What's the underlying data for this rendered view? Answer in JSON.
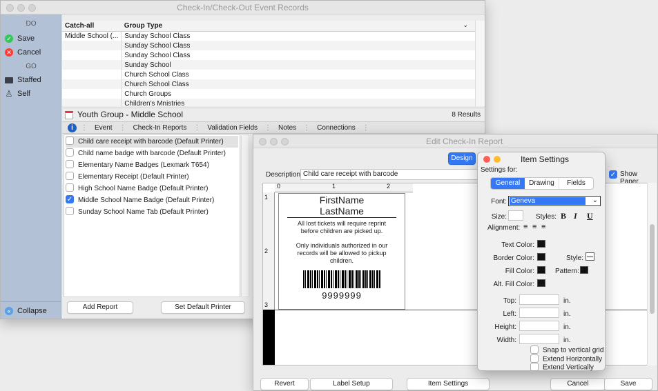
{
  "main_window": {
    "title": "Check-In/Check-Out Event Records",
    "sidebar": {
      "do_heading": "DO",
      "go_heading": "GO",
      "items": [
        {
          "label": "Save",
          "icon": "check-icon",
          "color": "#34c759"
        },
        {
          "label": "Cancel",
          "icon": "x-icon",
          "color": "#ff3b30"
        },
        {
          "label": "Staffed",
          "icon": "monitor-icon"
        },
        {
          "label": "Self",
          "icon": "person-icon"
        }
      ],
      "collapse_label": "Collapse"
    },
    "table": {
      "headers": [
        "Catch-all",
        "Group Type"
      ],
      "rows": [
        [
          "Middle School (...",
          "Sunday School Class"
        ],
        [
          "",
          "Sunday School Class"
        ],
        [
          "",
          "Sunday School Class"
        ],
        [
          "",
          "Sunday School"
        ],
        [
          "",
          "Church School Class"
        ],
        [
          "",
          "Church School Class"
        ],
        [
          "",
          "Church Groups"
        ],
        [
          "",
          "Children's Mnistries"
        ]
      ]
    },
    "record_title": "Youth Group - Middle School",
    "results": "8 Results",
    "tabs": [
      "Event",
      "Check-In Reports",
      "Validation Fields",
      "Notes",
      "Connections"
    ],
    "reports": [
      {
        "label": "Child care receipt with barcode (Default Printer)",
        "checked": false,
        "selected": true
      },
      {
        "label": "Child name badge with barcode (Default Printer)",
        "checked": false
      },
      {
        "label": "Elementary Name Badges (Lexmark T654)",
        "checked": false
      },
      {
        "label": "Elementary Receipt (Default Printer)",
        "checked": false
      },
      {
        "label": "High School Name Badge (Default Printer)",
        "checked": false
      },
      {
        "label": "Middle School Name Badge (Default Printer)",
        "checked": true
      },
      {
        "label": "Sunday School Name Tab (Default Printer)",
        "checked": false
      }
    ],
    "add_report": "Add Report",
    "set_default_printer": "Set Default Printer"
  },
  "edit_window": {
    "title": "Edit Check-In Report",
    "design_button": "Design",
    "description_label": "Description:",
    "description_value": "Child care receipt with barcode",
    "show_paper": "Show Paper",
    "ruler_top": [
      "0",
      "1",
      "2"
    ],
    "ruler_left": [
      "1",
      "2",
      "3"
    ],
    "label": {
      "first_name": "FirstName",
      "last_name": "LastName",
      "notice1": "All lost tickets will require reprint before children are picked up.",
      "notice2": "Only individuals authorized in our records will be allowed to pickup children.",
      "barcode_number": "9999999"
    },
    "buttons": {
      "revert": "Revert",
      "label_setup": "Label Setup",
      "item_settings": "Item Settings",
      "cancel": "Cancel",
      "save": "Save"
    }
  },
  "item_settings": {
    "title": "Item Settings",
    "settings_for": "Settings for:",
    "tabs": [
      "General",
      "Drawing",
      "Fields"
    ],
    "font_label": "Font:",
    "font_value": "Geneva",
    "size_label": "Size:",
    "styles_label": "Styles:",
    "style_b": "B",
    "style_i": "I",
    "style_u": "U",
    "alignment_label": "Alignment:",
    "text_color": "Text Color:",
    "border_color": "Border Color:",
    "style_label": "Style:",
    "fill_color": "Fill Color:",
    "pattern_label": "Pattern:",
    "alt_fill_color": "Alt. Fill Color:",
    "top": "Top:",
    "left": "Left:",
    "height": "Height:",
    "width": "Width:",
    "unit": "in.",
    "snap": "Snap to vertical grid",
    "extend_h": "Extend Horizontally",
    "extend_v": "Extend Vertically"
  }
}
